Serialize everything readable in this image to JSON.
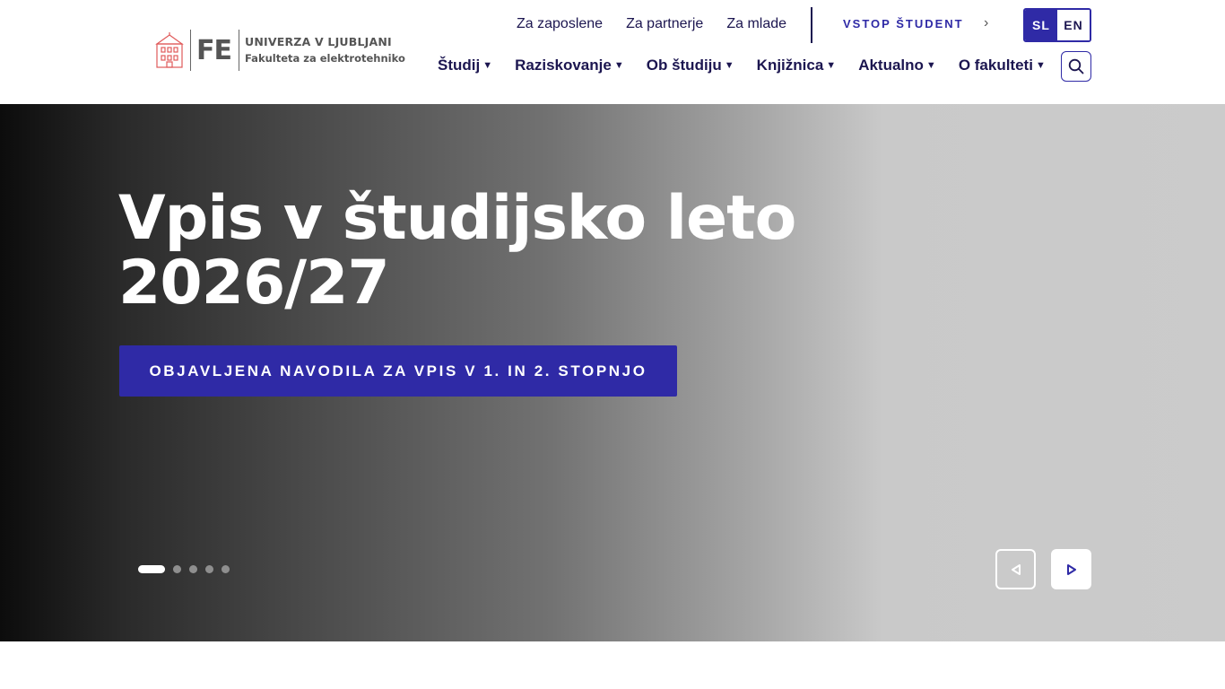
{
  "header": {
    "logo": {
      "abbr": "FE",
      "university": "UNIVERZA V LJUBLJANI",
      "faculty": "Fakulteta za elektrotehniko"
    },
    "top_links": [
      {
        "label": "Za zaposlene"
      },
      {
        "label": "Za partnerje"
      },
      {
        "label": "Za mlade"
      }
    ],
    "student_login": "VSTOP ŠTUDENT",
    "languages": {
      "active": "SL",
      "other": "EN"
    },
    "nav": [
      {
        "label": "Študij"
      },
      {
        "label": "Raziskovanje"
      },
      {
        "label": "Ob študiju"
      },
      {
        "label": "Knjižnica"
      },
      {
        "label": "Aktualno"
      },
      {
        "label": "O fakulteti"
      }
    ]
  },
  "hero": {
    "title": "Vpis v študijsko leto 2026/27",
    "cta": "OBJAVLJENA NAVODILA ZA VPIS V 1. IN 2. STOPNJO",
    "slides_total": 5,
    "active_slide": 1
  },
  "colors": {
    "brand": "#2f2aa6",
    "text": "#1c1650"
  },
  "icons": {
    "search": "search-icon",
    "prev": "play-left-icon",
    "next": "play-right-icon",
    "chevron": "chevron-right-icon",
    "caret": "caret-down-icon"
  }
}
